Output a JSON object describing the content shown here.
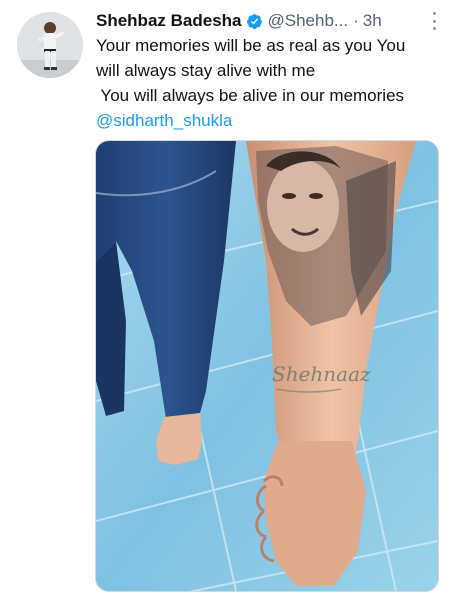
{
  "tweet": {
    "display_name": "Shehbaz Badesha",
    "handle": "@Shehb...",
    "separator": "·",
    "time": "3h",
    "text_lines": [
      "Your memories will be as real as you You",
      "will always stay alive with me",
      " You will always be alive in our memories"
    ],
    "mention": "@sidharth_shukla",
    "media": {
      "tattoo_text": "Shehnaaz"
    }
  },
  "icons": {
    "verified": "verified-badge-icon",
    "more": "more-options-icon"
  },
  "colors": {
    "verified_blue": "#1d9bf0",
    "mention_blue": "#1d9bf0",
    "secondary_text": "#536471"
  }
}
